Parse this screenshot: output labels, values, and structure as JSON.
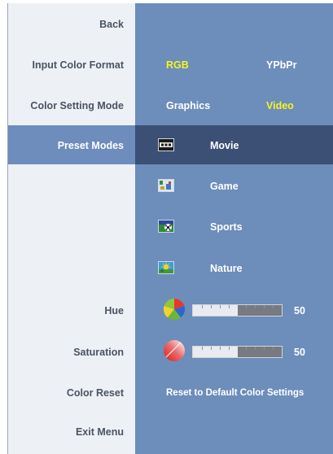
{
  "menu": {
    "back": "Back",
    "input_color_format": "Input Color Format",
    "color_setting_mode": "Color Setting Mode",
    "preset_modes": "Preset Modes",
    "hue": "Hue",
    "saturation": "Saturation",
    "color_reset": "Color Reset",
    "exit_menu": "Exit Menu"
  },
  "input_color_format": {
    "options": [
      "RGB",
      "YPbPr"
    ],
    "selected": "RGB"
  },
  "color_setting_mode": {
    "options": [
      "Graphics",
      "Video"
    ],
    "selected": "Video"
  },
  "preset_modes": [
    {
      "label": "Movie",
      "icon": "movie-icon"
    },
    {
      "label": "Game",
      "icon": "game-icon"
    },
    {
      "label": "Sports",
      "icon": "sports-icon"
    },
    {
      "label": "Nature",
      "icon": "nature-icon"
    }
  ],
  "hue": {
    "value": "50",
    "level": 0.5,
    "icon": "hue-color-wheel-icon"
  },
  "saturation": {
    "value": "50",
    "level": 0.5,
    "icon": "saturation-icon"
  },
  "color_reset_action": "Reset to Default Color Settings",
  "colors": {
    "panel_bg": "#6d8dbb",
    "left_column_bg": "#edf1f6",
    "selected_row": "#3b5074",
    "selected_option": "#f5f51e"
  }
}
